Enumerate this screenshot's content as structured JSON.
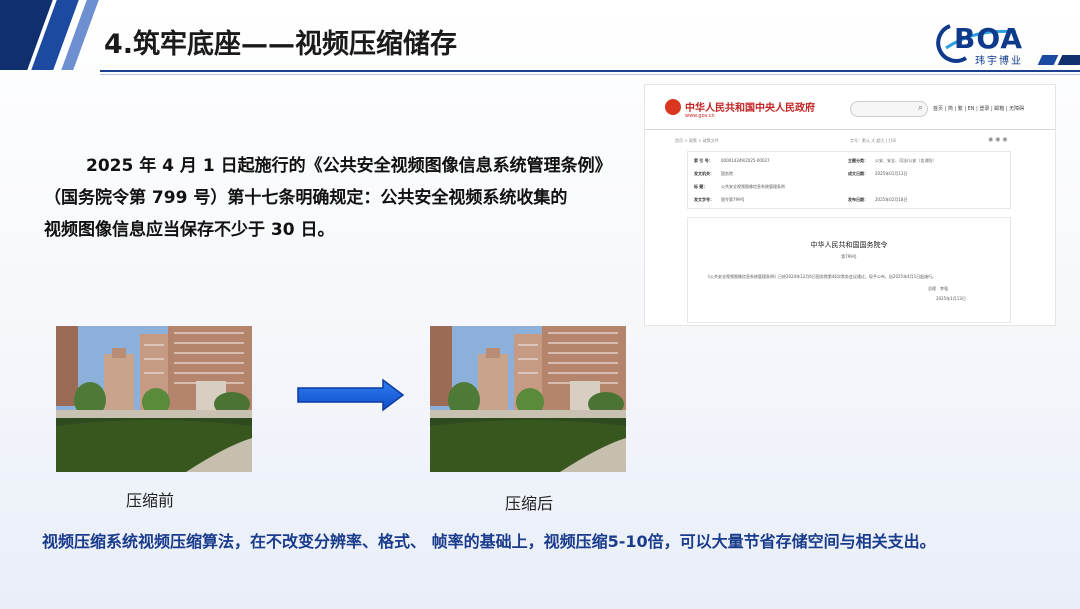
{
  "header": {
    "title": "4.筑牢底座——视频压缩储存",
    "logo_text": "BOA",
    "logo_sub": "玮宇博业"
  },
  "law_text": {
    "line1": "2025 年 4 月 1 日起施行的《公共安全视频图像信息系统管理条例》",
    "line2": "（国务院令第 799 号）第十七条明确规定：公共安全视频系统收集的",
    "line3": "视频图像信息应当保存不少于 30 日。"
  },
  "document": {
    "site_name": "中华人民共和国中央人民政府",
    "site_url": "www.gov.cn",
    "nav": "首页 | 简 | 繁 | EN | 登录 | 邮箱 | 无障碍",
    "crumbs_left": "首页 > 政策 > 政策文件",
    "crumbs_right": "字号：默认 大 超大 | 打印",
    "meta": [
      {
        "k": "索 引 号：",
        "v": "000014349/2025-00027"
      },
      {
        "k": "主题分类：",
        "v": "公安、安全、司法/公安（含消防）"
      },
      {
        "k": "发文机关：",
        "v": "国务院"
      },
      {
        "k": "成文日期：",
        "v": "2025年01月13日"
      },
      {
        "k": "标 题：",
        "v": "公共安全视频图像信息系统管理条例"
      },
      {
        "k": "发文字号：",
        "v": "国令第799号"
      },
      {
        "k": "发布日期：",
        "v": "2025年02月18日"
      }
    ],
    "notice_title": "中华人民共和国国务院令",
    "notice_no": "第799号",
    "notice_body": "《公共安全视频图像信息系统管理条例》已经2024年12月6日国务院第46次常务会议通过，现予公布，自2025年4月1日起施行。",
    "notice_sig": "总理　李强",
    "notice_date": "2025年1月13日"
  },
  "images": {
    "before_caption": "压缩前",
    "after_caption": "压缩后"
  },
  "summary": "视频压缩系统视频压缩算法，在不改变分辨率、格式、 帧率的基础上，视频压缩5-10倍，可以大量节省存储空间与相关支出。",
  "colors": {
    "brand_blue": "#1a3c8c",
    "gov_red": "#c32323"
  }
}
